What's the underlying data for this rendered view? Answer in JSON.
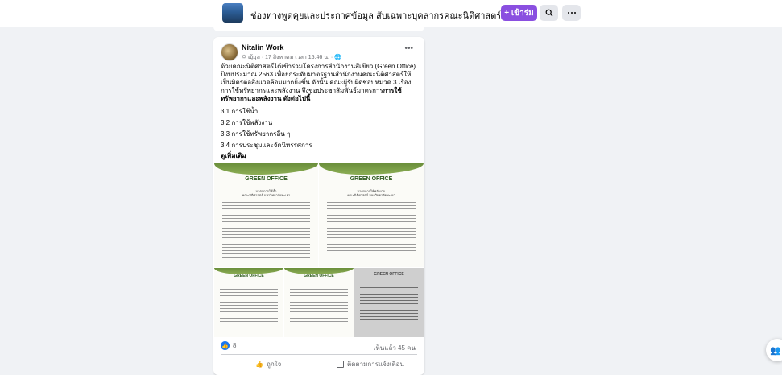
{
  "header": {
    "group_title": "ช่องทางพูดคุยและประกาศข้อมูล สับเฉพาะบุคลากรคณะนิติศาสตร์ม.พะเยา",
    "join_label": "+ เข้าร่ม",
    "search_icon": "search-icon",
    "more_icon": "more-horizontal-icon"
  },
  "post": {
    "author": "Nitalin Work",
    "meta": "🌣 ญุ้มุล · 17 สิงหาคม เวลา 15:46 น. · 🌐",
    "paragraph": "ด้วยคณะนิติศาสตร์ได้เข้าร่วมโครงการสำนักงานสีเขียว (Green Office) ปีงบประมาณ 2563 เพื่อยกระดับมาตรฐานสำนักงานคณะนิติศาสตร์ให้เป็นมิตรต่อสิ่งแวดล้อมมากยิ่งขึ้น ดังนั้น คณะผู้รับผิดชอบหมวด 3 เรื่อง การใช้ทรัพยากรและพลังงาน จึงขอประชาสัมพันธ์มาตรการ",
    "paragraph_bold": "การใช้ทรัพยากรและพลังงาน ดังต่อไปนี้",
    "items": [
      "3.1 การใช้น้ำ",
      "3.2 การใช้พลังงาน",
      "3.3 การใช้ทรัพยากรอื่น ๆ",
      "3.4 การประชุมและจัดนิทรรศการ"
    ],
    "see_more": "ดูเพิ่มเติม",
    "doc_logo": "GREEN OFFICE",
    "doc_heading_1": "มาตรการใช้น้ำ",
    "doc_heading_2": "มาตรการใช้พลังงาน",
    "doc_subheading": "คณะนิติศาสตร์ มหาวิทยาลัยพะเยา",
    "reaction_count": "8",
    "seen_by": "เห็นแล้ว 45 คน",
    "like_label": "ถูกใจ",
    "follow_label": "ติดตามการแจ้งเตือน"
  }
}
